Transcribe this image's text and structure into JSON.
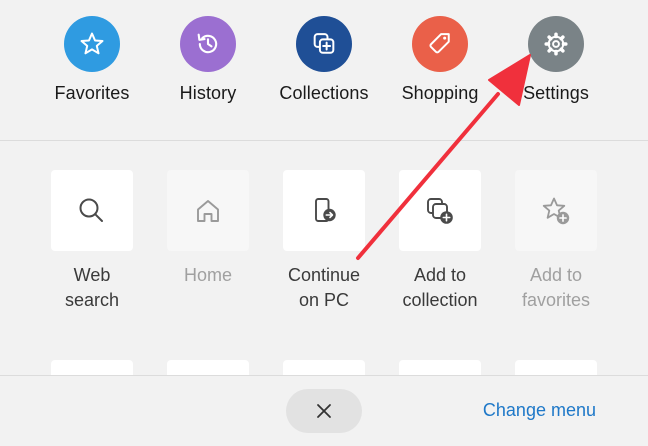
{
  "top_actions": [
    {
      "label": "Favorites",
      "icon": "star-icon",
      "color": "#2f9be1"
    },
    {
      "label": "History",
      "icon": "history-icon",
      "color": "#9b6fd1"
    },
    {
      "label": "Collections",
      "icon": "collections-icon",
      "color": "#1f4f96"
    },
    {
      "label": "Shopping",
      "icon": "tag-icon",
      "color": "#ea6049"
    },
    {
      "label": "Settings",
      "icon": "gear-icon",
      "color": "#7a8387"
    }
  ],
  "tiles": [
    {
      "label": [
        "Web",
        "search"
      ],
      "icon": "search-icon",
      "enabled": true
    },
    {
      "label": [
        "Home"
      ],
      "icon": "home-icon",
      "enabled": false
    },
    {
      "label": [
        "Continue",
        "on PC"
      ],
      "icon": "continue-on-pc-icon",
      "enabled": true
    },
    {
      "label": [
        "Add to",
        "collection"
      ],
      "icon": "add-to-collection-icon",
      "enabled": true
    },
    {
      "label": [
        "Add to",
        "favorites"
      ],
      "icon": "add-favorite-icon",
      "enabled": false
    }
  ],
  "bottom_bar": {
    "close_icon": "close-icon",
    "change_menu_label": "Change menu"
  },
  "annotation": {
    "type": "arrow",
    "color": "#f0303c",
    "target": "Settings"
  }
}
